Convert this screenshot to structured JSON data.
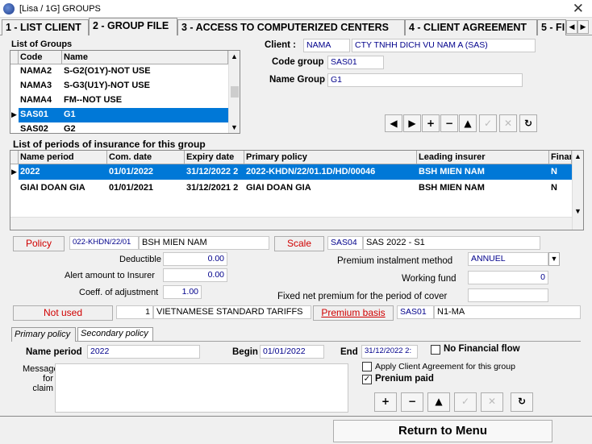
{
  "window": {
    "title": "[Lisa / 1G] GROUPS",
    "close": "✕"
  },
  "tabs": [
    "1 - LIST CLIENT",
    "2 - GROUP FILE",
    "3 - ACCESS TO COMPUTERIZED CENTERS",
    "4 - CLIENT AGREEMENT",
    "5 - FI"
  ],
  "groups": {
    "title": "List of Groups",
    "columns": [
      "Code",
      "Name"
    ],
    "rows": [
      {
        "code": "",
        "name": ""
      },
      {
        "code": "NAMA2",
        "name": "S-G2(O1Y)-NOT USE"
      },
      {
        "code": "NAMA3",
        "name": "S-G3(U1Y)-NOT USE"
      },
      {
        "code": "NAMA4",
        "name": "FM--NOT USE"
      },
      {
        "code": "SAS01",
        "name": "G1"
      },
      {
        "code": "SAS02",
        "name": "G2"
      }
    ]
  },
  "client": {
    "label": "Client :",
    "code": "NAMA",
    "name": "CTY TNHH DICH VU NAM A (SAS)"
  },
  "code_group": {
    "label": "Code group",
    "value": "SAS01"
  },
  "name_group": {
    "label": "Name Group",
    "value": "G1"
  },
  "nav_buttons": [
    "◀",
    "▶",
    "+",
    "−",
    "▲",
    "✓",
    "✕",
    "↻"
  ],
  "periods": {
    "title": "List of periods of insurance for this group",
    "columns": [
      "Name period",
      "Com. date",
      "Expiry date",
      "Primary policy",
      "Leading insurer",
      "Finan"
    ],
    "rows": [
      {
        "name": "2022",
        "com": "01/01/2022",
        "exp": "31/12/2022 2",
        "policy": "2022-KHDN/22/01.1D/HD/00046",
        "insurer": "BSH MIEN NAM",
        "fin": "N"
      },
      {
        "name": "GIAI DOAN GIA",
        "com": "01/01/2021",
        "exp": "31/12/2021 2",
        "policy": "GIAI DOAN GIA",
        "insurer": "BSH MIEN NAM",
        "fin": "N"
      }
    ]
  },
  "policy": {
    "btn": "Policy",
    "code": "022-KHDN/22/01",
    "insurer": "BSH MIEN NAM"
  },
  "scale": {
    "btn": "Scale",
    "code": "SAS04",
    "name": "SAS 2022 - S1"
  },
  "deductible": {
    "label": "Deductible",
    "value": "0.00"
  },
  "alert": {
    "label": "Alert amount to Insurer",
    "value": "0.00"
  },
  "coeff": {
    "label": "Coeff. of adjustment",
    "value": "1.00"
  },
  "premium_method": {
    "label": "Premium instalment method",
    "value": "ANNUEL"
  },
  "working_fund": {
    "label": "Working fund",
    "value": "0"
  },
  "fixed_net": {
    "label": "Fixed net premium for the period of cover",
    "value": ""
  },
  "not_used": {
    "btn": "Not used",
    "num": "1",
    "text": "VIETNAMESE STANDARD TARIFFS"
  },
  "premium_basis": {
    "btn": "Premium basis",
    "code": "SAS01",
    "name": "N1-MA"
  },
  "subtabs": [
    "Primary policy",
    "Secondary policy"
  ],
  "name_period": {
    "label": "Name period",
    "value": "2022"
  },
  "begin": {
    "label": "Begin",
    "value": "01/01/2022"
  },
  "end": {
    "label": "End",
    "value": "31/12/2022 2:"
  },
  "no_financial": {
    "label": "No Financial flow",
    "checked": ""
  },
  "message": {
    "label": "Message for claim"
  },
  "apply_agreement": {
    "label": "Apply Client Agreement for this group",
    "checked": ""
  },
  "premium_paid": {
    "label": "Prenium paid",
    "checked": "✓"
  },
  "bottom_buttons": [
    "+",
    "−",
    "▲",
    "✓",
    "✕",
    "↻"
  ],
  "return_btn": "Return to Menu"
}
